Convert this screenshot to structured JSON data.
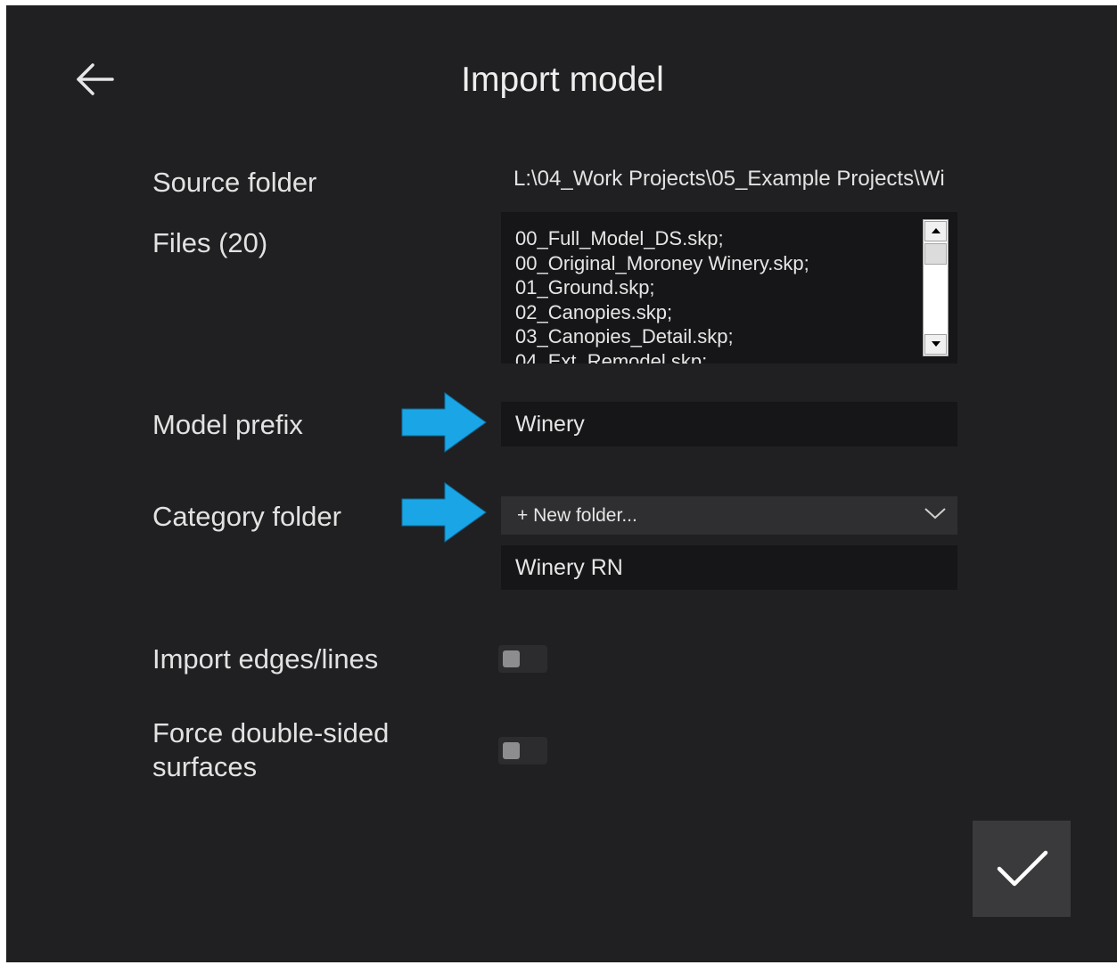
{
  "header": {
    "title": "Import model",
    "back_icon": "arrow-left-icon"
  },
  "form": {
    "source_folder": {
      "label": "Source folder",
      "value": "L:\\04_Work Projects\\05_Example Projects\\Wi"
    },
    "files": {
      "label": "Files (20)",
      "items": [
        "00_Full_Model_DS.skp;",
        "00_Original_Moroney Winery.skp;",
        "01_Ground.skp;",
        "02_Canopies.skp;",
        "03_Canopies_Detail.skp;",
        "04_Ext_Remodel.skp;"
      ]
    },
    "model_prefix": {
      "label": "Model prefix",
      "value": "Winery"
    },
    "category_folder": {
      "label": "Category folder",
      "selected": "+ New folder...",
      "new_folder_name": "Winery RN"
    },
    "import_edges": {
      "label": "Import edges/lines",
      "on": false
    },
    "force_double_sided": {
      "label_line1": "Force double-sided",
      "label_line2": "surfaces",
      "on": false
    }
  },
  "annotations": {
    "arrow_color": "#1aa6e6",
    "arrow_icon": "arrow-right-icon"
  },
  "actions": {
    "confirm_icon": "checkmark-icon"
  },
  "colors": {
    "background": "#202022",
    "field": "#161618",
    "dropdown": "#2f2f31",
    "confirm": "#3a3a3c"
  }
}
